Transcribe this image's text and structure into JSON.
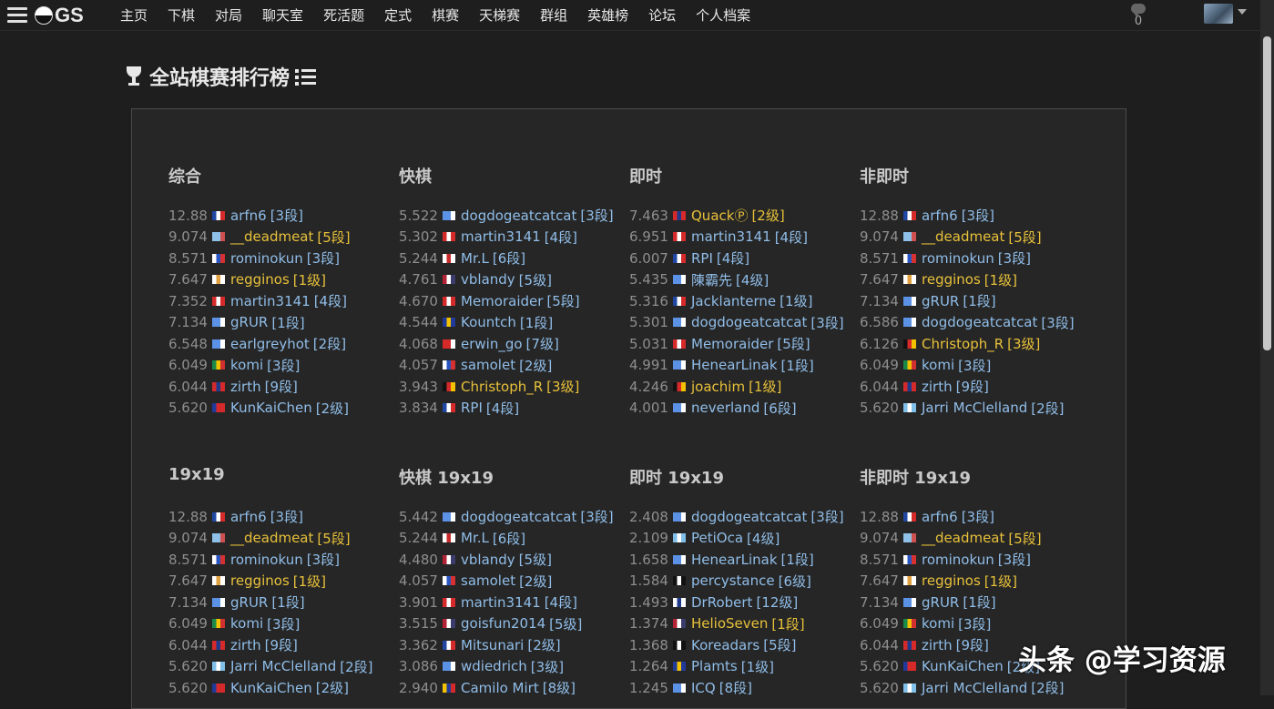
{
  "nav": {
    "logo": "GS",
    "items": [
      "主页",
      "下棋",
      "对局",
      "聊天室",
      "死活题",
      "定式",
      "棋赛",
      "天梯赛",
      "群组",
      "英雄榜",
      "论坛",
      "个人档案"
    ],
    "chat_count": "0"
  },
  "page": {
    "title": "全站棋赛排行榜"
  },
  "colors": {
    "link": "#90bde8",
    "gold": "#e8c13a",
    "rating": "#8e8e8e",
    "background": "#1e1e1e",
    "card": "#262626"
  },
  "flag_colors": {
    "fr": [
      "#1f47a3",
      "#ffffff",
      "#d62a2a"
    ],
    "un": [
      "#5b92e5",
      "#5b92e5",
      "#ffffff"
    ],
    "tv": [
      "#8fc0e8",
      "#8fc0e8",
      "#d05050"
    ],
    "ru": [
      "#ffffff",
      "#2a55c0",
      "#d63030"
    ],
    "cy": [
      "#ffffff",
      "#e0a040",
      "#ffffff"
    ],
    "at": [
      "#d62a2a",
      "#ffffff",
      "#d62a2a"
    ],
    "za": [
      "#1a8a4a",
      "#f2c200",
      "#d03030"
    ],
    "th": [
      "#d62a2a",
      "#1f3a8a",
      "#d62a2a"
    ],
    "tw": [
      "#1f3a9a",
      "#d62a2a",
      "#d62a2a"
    ],
    "kr": [
      "#ffffff",
      "#c82a2a",
      "#ffffff"
    ],
    "us": [
      "#b22234",
      "#ffffff",
      "#3c3b6e"
    ],
    "hk": [
      "#d62a2a",
      "#ffffff",
      "#d62a2a"
    ],
    "eu": [
      "#1f3a9a",
      "#f2c200",
      "#1f3a9a"
    ],
    "id": [
      "#d62a2a",
      "#d62a2a",
      "#ffffff"
    ],
    "de": [
      "#111111",
      "#d62a2a",
      "#f2c200"
    ],
    "ar": [
      "#7fbfe8",
      "#ffffff",
      "#7fbfe8"
    ],
    "pw": [
      "#4aa8e0",
      "#f2d200",
      "#4aa8e0"
    ],
    "pirate": [
      "#111111",
      "#ffffff",
      "#111111"
    ],
    "fi": [
      "#ffffff",
      "#1f3a8a",
      "#ffffff"
    ],
    "ba": [
      "#1f3a9a",
      "#f2c200",
      "#1f3a9a"
    ],
    "ec": [
      "#f2c200",
      "#1f3a9a",
      "#d62a2a"
    ]
  },
  "sections": [
    {
      "title": "综合",
      "rows": [
        {
          "rating": "12.88",
          "flag": "fr",
          "name": "arfn6",
          "rank": "[3段]",
          "gold": false
        },
        {
          "rating": "9.074",
          "flag": "tv",
          "name": "__deadmeat",
          "rank": "[5段]",
          "gold": true
        },
        {
          "rating": "8.571",
          "flag": "ru",
          "name": "rominokun",
          "rank": "[3段]",
          "gold": false
        },
        {
          "rating": "7.647",
          "flag": "cy",
          "name": "regginos",
          "rank": "[1级]",
          "gold": true
        },
        {
          "rating": "7.352",
          "flag": "at",
          "name": "martin3141",
          "rank": "[4段]",
          "gold": false
        },
        {
          "rating": "7.134",
          "flag": "un",
          "name": "gRUR",
          "rank": "[1段]",
          "gold": false
        },
        {
          "rating": "6.548",
          "flag": "un",
          "name": "earlgreyhot",
          "rank": "[2段]",
          "gold": false
        },
        {
          "rating": "6.049",
          "flag": "za",
          "name": "komi",
          "rank": "[3段]",
          "gold": false
        },
        {
          "rating": "6.044",
          "flag": "th",
          "name": "zirth",
          "rank": "[9段]",
          "gold": false
        },
        {
          "rating": "5.620",
          "flag": "tw",
          "name": "KunKaiChen",
          "rank": "[2级]",
          "gold": false
        }
      ]
    },
    {
      "title": "快棋",
      "rows": [
        {
          "rating": "5.522",
          "flag": "un",
          "name": "dogdogeatcatcat",
          "rank": "[3段]",
          "gold": false
        },
        {
          "rating": "5.302",
          "flag": "at",
          "name": "martin3141",
          "rank": "[4段]",
          "gold": false
        },
        {
          "rating": "5.244",
          "flag": "kr",
          "name": "Mr.L",
          "rank": "[6段]",
          "gold": false
        },
        {
          "rating": "4.761",
          "flag": "us",
          "name": "vblandy",
          "rank": "[5级]",
          "gold": false
        },
        {
          "rating": "4.670",
          "flag": "hk",
          "name": "Memoraider",
          "rank": "[5段]",
          "gold": false
        },
        {
          "rating": "4.544",
          "flag": "eu",
          "name": "Kountch",
          "rank": "[1段]",
          "gold": false
        },
        {
          "rating": "4.068",
          "flag": "id",
          "name": "erwin_go",
          "rank": "[7级]",
          "gold": false
        },
        {
          "rating": "4.057",
          "flag": "ru",
          "name": "samolet",
          "rank": "[2级]",
          "gold": false
        },
        {
          "rating": "3.943",
          "flag": "de",
          "name": "Christoph_R",
          "rank": "[3级]",
          "gold": true
        },
        {
          "rating": "3.834",
          "flag": "fr",
          "name": "RPI",
          "rank": "[4段]",
          "gold": false
        }
      ]
    },
    {
      "title": "即时",
      "rows": [
        {
          "rating": "7.463",
          "flag": "th",
          "name": "QuackⓅ",
          "rank": "[2级]",
          "gold": true
        },
        {
          "rating": "6.951",
          "flag": "at",
          "name": "martin3141",
          "rank": "[4段]",
          "gold": false
        },
        {
          "rating": "6.007",
          "flag": "fr",
          "name": "RPI",
          "rank": "[4段]",
          "gold": false
        },
        {
          "rating": "5.435",
          "flag": "un",
          "name": "陳霸先",
          "rank": "[4级]",
          "gold": false
        },
        {
          "rating": "5.316",
          "flag": "fr",
          "name": "Jacklanterne",
          "rank": "[1级]",
          "gold": false
        },
        {
          "rating": "5.301",
          "flag": "un",
          "name": "dogdogeatcatcat",
          "rank": "[3段]",
          "gold": false
        },
        {
          "rating": "5.031",
          "flag": "hk",
          "name": "Memoraider",
          "rank": "[5段]",
          "gold": false
        },
        {
          "rating": "4.991",
          "flag": "un",
          "name": "HenearLinak",
          "rank": "[1段]",
          "gold": false
        },
        {
          "rating": "4.246",
          "flag": "de",
          "name": "joachim",
          "rank": "[1级]",
          "gold": true
        },
        {
          "rating": "4.001",
          "flag": "un",
          "name": "neverland",
          "rank": "[6段]",
          "gold": false
        }
      ]
    },
    {
      "title": "非即时",
      "rows": [
        {
          "rating": "12.88",
          "flag": "fr",
          "name": "arfn6",
          "rank": "[3段]",
          "gold": false
        },
        {
          "rating": "9.074",
          "flag": "tv",
          "name": "__deadmeat",
          "rank": "[5段]",
          "gold": true
        },
        {
          "rating": "8.571",
          "flag": "ru",
          "name": "rominokun",
          "rank": "[3段]",
          "gold": false
        },
        {
          "rating": "7.647",
          "flag": "cy",
          "name": "regginos",
          "rank": "[1级]",
          "gold": true
        },
        {
          "rating": "7.134",
          "flag": "un",
          "name": "gRUR",
          "rank": "[1段]",
          "gold": false
        },
        {
          "rating": "6.586",
          "flag": "un",
          "name": "dogdogeatcatcat",
          "rank": "[3段]",
          "gold": false
        },
        {
          "rating": "6.126",
          "flag": "de",
          "name": "Christoph_R",
          "rank": "[3级]",
          "gold": true
        },
        {
          "rating": "6.049",
          "flag": "za",
          "name": "komi",
          "rank": "[3段]",
          "gold": false
        },
        {
          "rating": "6.044",
          "flag": "th",
          "name": "zirth",
          "rank": "[9段]",
          "gold": false
        },
        {
          "rating": "5.620",
          "flag": "ar",
          "name": "Jarri McClelland",
          "rank": "[2段]",
          "gold": false
        }
      ]
    },
    {
      "title": "19x19",
      "rows": [
        {
          "rating": "12.88",
          "flag": "fr",
          "name": "arfn6",
          "rank": "[3段]",
          "gold": false
        },
        {
          "rating": "9.074",
          "flag": "tv",
          "name": "__deadmeat",
          "rank": "[5段]",
          "gold": true
        },
        {
          "rating": "8.571",
          "flag": "ru",
          "name": "rominokun",
          "rank": "[3段]",
          "gold": false
        },
        {
          "rating": "7.647",
          "flag": "cy",
          "name": "regginos",
          "rank": "[1级]",
          "gold": true
        },
        {
          "rating": "7.134",
          "flag": "un",
          "name": "gRUR",
          "rank": "[1段]",
          "gold": false
        },
        {
          "rating": "6.049",
          "flag": "za",
          "name": "komi",
          "rank": "[3段]",
          "gold": false
        },
        {
          "rating": "6.044",
          "flag": "th",
          "name": "zirth",
          "rank": "[9段]",
          "gold": false
        },
        {
          "rating": "5.620",
          "flag": "ar",
          "name": "Jarri McClelland",
          "rank": "[2段]",
          "gold": false
        },
        {
          "rating": "5.620",
          "flag": "tw",
          "name": "KunKaiChen",
          "rank": "[2级]",
          "gold": false
        }
      ]
    },
    {
      "title": "快棋 19x19",
      "rows": [
        {
          "rating": "5.442",
          "flag": "un",
          "name": "dogdogeatcatcat",
          "rank": "[3段]",
          "gold": false
        },
        {
          "rating": "5.244",
          "flag": "kr",
          "name": "Mr.L",
          "rank": "[6段]",
          "gold": false
        },
        {
          "rating": "4.480",
          "flag": "us",
          "name": "vblandy",
          "rank": "[5级]",
          "gold": false
        },
        {
          "rating": "4.057",
          "flag": "ru",
          "name": "samolet",
          "rank": "[2级]",
          "gold": false
        },
        {
          "rating": "3.901",
          "flag": "at",
          "name": "martin3141",
          "rank": "[4段]",
          "gold": false
        },
        {
          "rating": "3.515",
          "flag": "us",
          "name": "goisfun2014",
          "rank": "[5级]",
          "gold": false
        },
        {
          "rating": "3.362",
          "flag": "fr",
          "name": "Mitsunari",
          "rank": "[2级]",
          "gold": false
        },
        {
          "rating": "3.086",
          "flag": "un",
          "name": "wdiedrich",
          "rank": "[3级]",
          "gold": false
        },
        {
          "rating": "2.940",
          "flag": "ec",
          "name": "Camilo Mirt",
          "rank": "[8级]",
          "gold": false
        }
      ]
    },
    {
      "title": "即时 19x19",
      "rows": [
        {
          "rating": "2.408",
          "flag": "un",
          "name": "dogdogeatcatcat",
          "rank": "[3段]",
          "gold": false
        },
        {
          "rating": "2.109",
          "flag": "ar",
          "name": "PetiOca",
          "rank": "[4级]",
          "gold": false
        },
        {
          "rating": "1.658",
          "flag": "un",
          "name": "HenearLinak",
          "rank": "[1段]",
          "gold": false
        },
        {
          "rating": "1.584",
          "flag": "pirate",
          "name": "percystance",
          "rank": "[6级]",
          "gold": false
        },
        {
          "rating": "1.493",
          "flag": "fi",
          "name": "DrRobert",
          "rank": "[12级]",
          "gold": false
        },
        {
          "rating": "1.374",
          "flag": "us",
          "name": "HelioSeven",
          "rank": "[1段]",
          "gold": true
        },
        {
          "rating": "1.368",
          "flag": "pirate",
          "name": "Koreadars",
          "rank": "[5段]",
          "gold": false
        },
        {
          "rating": "1.264",
          "flag": "ba",
          "name": "Plamts",
          "rank": "[1级]",
          "gold": false
        },
        {
          "rating": "1.245",
          "flag": "un",
          "name": "ICQ",
          "rank": "[8段]",
          "gold": false
        }
      ]
    },
    {
      "title": "非即时 19x19",
      "rows": [
        {
          "rating": "12.88",
          "flag": "fr",
          "name": "arfn6",
          "rank": "[3段]",
          "gold": false
        },
        {
          "rating": "9.074",
          "flag": "tv",
          "name": "__deadmeat",
          "rank": "[5段]",
          "gold": true
        },
        {
          "rating": "8.571",
          "flag": "ru",
          "name": "rominokun",
          "rank": "[3段]",
          "gold": false
        },
        {
          "rating": "7.647",
          "flag": "cy",
          "name": "regginos",
          "rank": "[1级]",
          "gold": true
        },
        {
          "rating": "7.134",
          "flag": "un",
          "name": "gRUR",
          "rank": "[1段]",
          "gold": false
        },
        {
          "rating": "6.049",
          "flag": "za",
          "name": "komi",
          "rank": "[3段]",
          "gold": false
        },
        {
          "rating": "6.044",
          "flag": "th",
          "name": "zirth",
          "rank": "[9段]",
          "gold": false
        },
        {
          "rating": "5.620",
          "flag": "tw",
          "name": "KunKaiChen",
          "rank": "[2级]",
          "gold": false
        },
        {
          "rating": "5.620",
          "flag": "ar",
          "name": "Jarri McClelland",
          "rank": "[2段]",
          "gold": false
        }
      ]
    }
  ],
  "watermark": "头条 @学习资源"
}
